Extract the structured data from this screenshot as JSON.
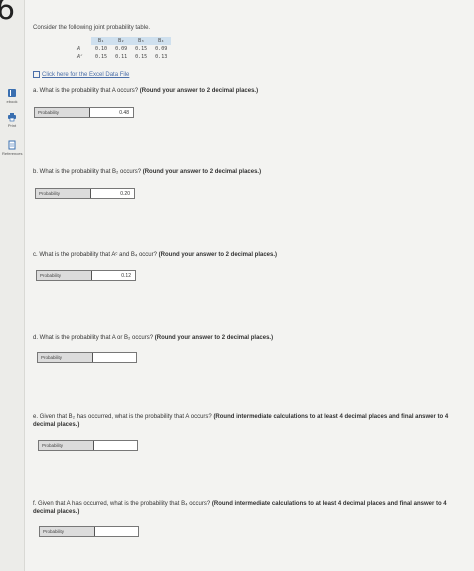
{
  "header": {
    "question_number": "6"
  },
  "sidebar": {
    "items": [
      {
        "label": "ebook",
        "icon": "book-icon"
      },
      {
        "label": "Print",
        "icon": "print-icon"
      },
      {
        "label": "References",
        "icon": "references-icon"
      }
    ]
  },
  "intro": "Consider the following joint probability table.",
  "table": {
    "columns": [
      "B₁",
      "B₂",
      "B₃",
      "B₄"
    ],
    "rows": [
      {
        "label": "A",
        "values": [
          "0.10",
          "0.09",
          "0.15",
          "0.09"
        ]
      },
      {
        "label": "Aᶜ",
        "values": [
          "0.15",
          "0.11",
          "0.15",
          "0.13"
        ]
      }
    ]
  },
  "excel_link": "Click here for the Excel Data File",
  "questions": [
    {
      "prefix": "a. What is the probability that A occurs?",
      "bold": "(Round your answer to 2 decimal places.)",
      "field_label": "Probability",
      "value": "0.48"
    },
    {
      "prefix": "b. What is the probability that B₂ occurs?",
      "bold": "(Round your answer to 2 decimal places.)",
      "field_label": "Probability",
      "value": "0.20"
    },
    {
      "prefix": "c. What is the probability that Aᶜ and B₄ occur?",
      "bold": "(Round your answer to 2 decimal places.)",
      "field_label": "Probability",
      "value": "0.12"
    },
    {
      "prefix": "d. What is the probability that A or B₂ occurs?",
      "bold": "(Round your answer to 2 decimal places.)",
      "field_label": "Probability",
      "value": ""
    },
    {
      "prefix": "e. Given that B₂ has occurred, what is the probability that A occurs?",
      "bold": "(Round intermediate calculations to at least 4 decimal places and final answer to 4 decimal places.)",
      "field_label": "Probability",
      "value": ""
    },
    {
      "prefix": "f. Given that A has occurred, what is the probability that B₄ occurs?",
      "bold": "(Round intermediate calculations to at least 4 decimal places and final answer to 4 decimal places.)",
      "field_label": "Probability",
      "value": ""
    }
  ]
}
